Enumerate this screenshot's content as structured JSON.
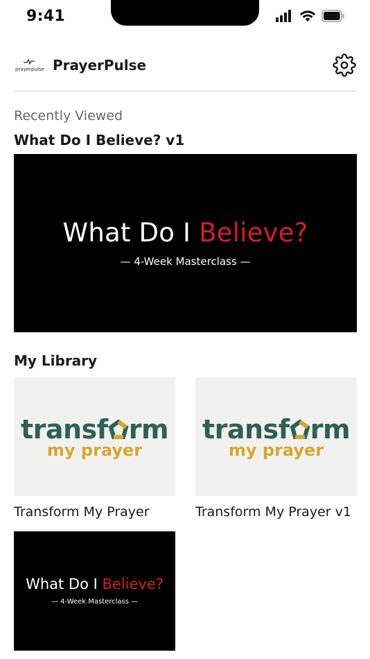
{
  "status_bar": {
    "time": "9:41",
    "icons": [
      "cellular-signal-icon",
      "wifi-icon",
      "battery-icon"
    ]
  },
  "header": {
    "logo_text": "prayerpulse",
    "title": "PrayerPulse",
    "settings_icon": "gear-icon"
  },
  "recently_viewed": {
    "label": "Recently Viewed",
    "item": {
      "title": "What Do I Believe? v1",
      "thumb_title_white": "What Do I",
      "thumb_title_red": "Believe?",
      "thumb_subtitle": "4-Week Masterclass"
    }
  },
  "library": {
    "heading": "My Library",
    "items": [
      {
        "caption": "Transform My Prayer",
        "thumb_line1": "transf",
        "thumb_line1_end": "rm",
        "thumb_line2": "my prayer"
      },
      {
        "caption": "Transform My Prayer v1",
        "thumb_line1": "transf",
        "thumb_line1_end": "rm",
        "thumb_line2": "my prayer"
      },
      {
        "caption": "",
        "thumb_title_white": "What Do I",
        "thumb_title_red": "Believe?",
        "thumb_subtitle": "4-Week Masterclass"
      }
    ]
  },
  "colors": {
    "accent_red": "#d0201f",
    "transform_green": "#2f5f55",
    "prayer_gold": "#d7a630"
  }
}
